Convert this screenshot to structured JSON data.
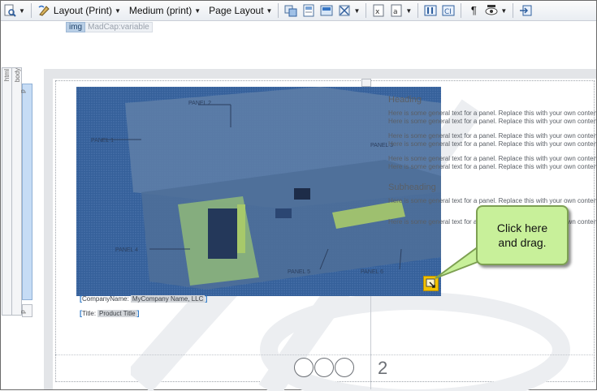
{
  "toolbar": {
    "layout": "Layout (Print)",
    "medium": "Medium (print)",
    "page_layout": "Page Layout"
  },
  "tags": {
    "img": "img",
    "variable": "MadCap:variable"
  },
  "structure_bars": [
    "html",
    "body",
    "p",
    "p"
  ],
  "document": {
    "heading": "Heading",
    "subheading": "Subheading",
    "paragraph_line1": "Here is some general text for a panel. Replace this with your own content.",
    "paragraph_line2": "Here is some general text for a panel. Replace this with your own content.",
    "paragraph_line3": "Here is some general text for a panel. Replace this with your own content.",
    "paragraph_line4": "Here is some general text for a panel. Replace this with your own content.",
    "paragraph_line5": "Here is some general text for a panel. Replace this with your own content.",
    "paragraph_line6": "Here is some general text for a panel. Replace this with your own content.",
    "paragraph_line7": "Here is some general text for a panel. Replace this with your own content.",
    "paragraph_line8": "Here is some general text for a panel. Replace this with your own content.",
    "panel_labels": [
      "PANEL 1",
      "PANEL 2",
      "PANEL 3",
      "PANEL 4",
      "PANEL 5",
      "PANEL 6"
    ]
  },
  "fields": {
    "company_label": "CompanyName:",
    "company_value": "MyCompany Name, LLC",
    "title_label": "Title:",
    "title_value": "Product Title"
  },
  "page_number": "2",
  "callout": {
    "line1": "Click here",
    "line2": "and drag."
  },
  "colors": {
    "selection": "#35609a",
    "callout_fill": "#c8f09a",
    "handle": "#f2c200"
  }
}
